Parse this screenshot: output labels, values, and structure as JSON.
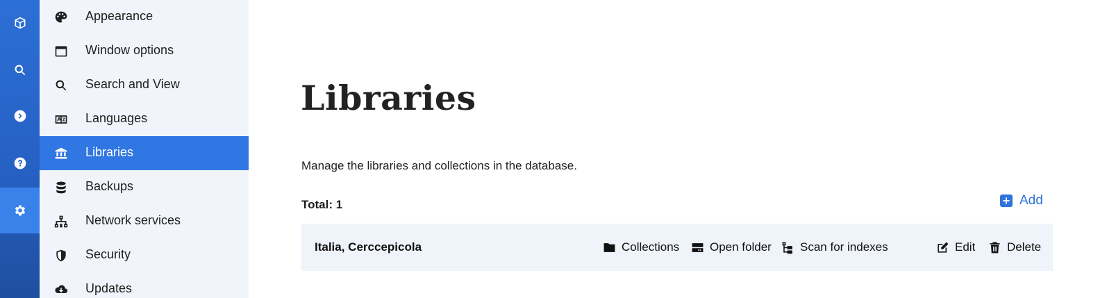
{
  "rail": {
    "items": [
      {
        "icon": "cube-icon"
      },
      {
        "icon": "search-icon"
      },
      {
        "icon": "chevron-right-circle-icon"
      },
      {
        "icon": "help-circle-icon"
      },
      {
        "icon": "gear-icon"
      }
    ],
    "active_index": 4
  },
  "sidebar": {
    "items": [
      {
        "label": "Appearance",
        "icon": "palette-icon"
      },
      {
        "label": "Window options",
        "icon": "window-icon"
      },
      {
        "label": "Search and View",
        "icon": "search-icon"
      },
      {
        "label": "Languages",
        "icon": "language-icon"
      },
      {
        "label": "Libraries",
        "icon": "library-icon"
      },
      {
        "label": "Backups",
        "icon": "database-icon"
      },
      {
        "label": "Network services",
        "icon": "network-icon"
      },
      {
        "label": "Security",
        "icon": "shield-icon"
      },
      {
        "label": "Updates",
        "icon": "cloud-download-icon"
      }
    ],
    "active_label": "Libraries"
  },
  "main": {
    "title": "Libraries",
    "description": "Manage the libraries and collections in the database.",
    "total_label": "Total: 1",
    "add_label": "Add",
    "libraries": [
      {
        "name": "Italia, Cerccepicola",
        "actions": {
          "collections": "Collections",
          "open_folder": "Open folder",
          "scan": "Scan for indexes",
          "edit": "Edit",
          "delete": "Delete"
        }
      }
    ]
  },
  "colors": {
    "accent": "#3077e3",
    "rail": "#2661c4",
    "sidebar_bg": "#f1f5fb",
    "row_bg": "#eff3fa",
    "add_link": "#2f74dc"
  }
}
